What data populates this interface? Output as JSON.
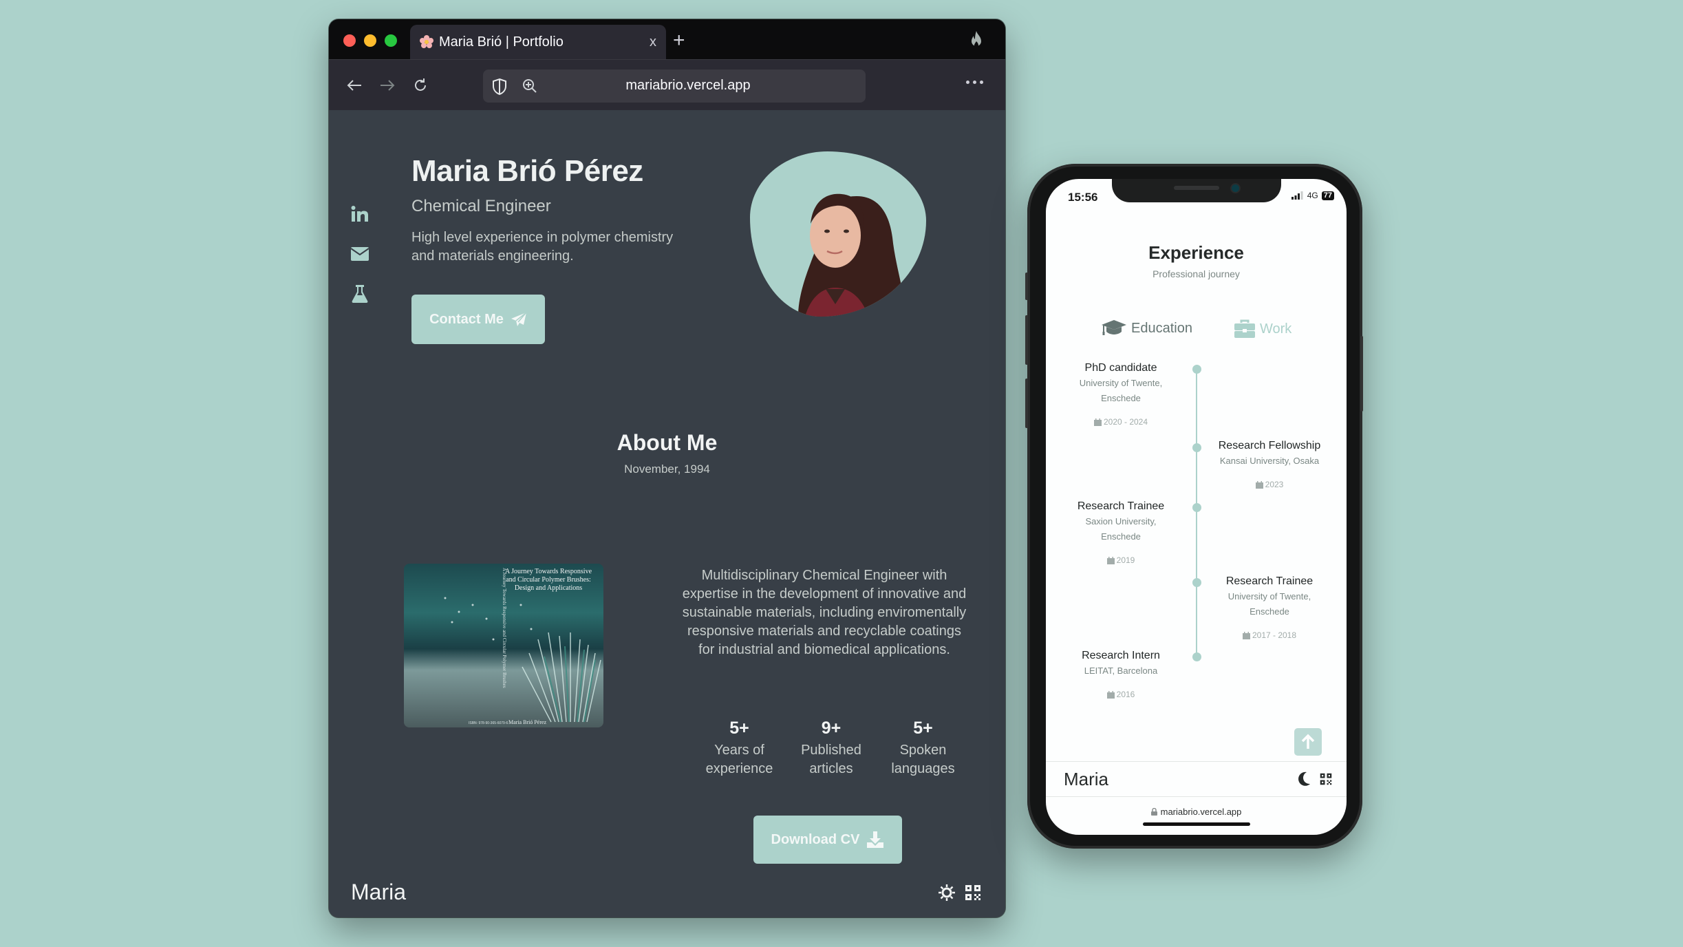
{
  "browser": {
    "tab_title": "Maria Brió | Portfolio",
    "tab_close": "x",
    "new_tab": "+",
    "url": "mariabrio.vercel.app",
    "icons": {
      "favicon": "cherry-blossom-icon",
      "private": "fire-icon",
      "back": "arrow-left-icon",
      "forward": "arrow-right-icon",
      "reload": "reload-icon",
      "shield": "shield-icon",
      "zoom": "zoom-in-icon",
      "menu": "more-horizontal-icon"
    }
  },
  "site": {
    "accent": "#acd2cb",
    "background": "#383f47",
    "social": [
      "linkedin-icon",
      "email-icon",
      "flask-icon"
    ],
    "hero": {
      "name": "Maria Brió Pérez",
      "role": "Chemical Engineer",
      "description": "High level experience in polymer chemistry and materials engineering.",
      "contact_button": "Contact Me"
    },
    "about": {
      "title": "About Me",
      "date": "November, 1994",
      "text": "Multidisciplinary Chemical Engineer with expertise in the development of innovative and sustainable materials, including enviromentally responsive materials and recyclable coatings for industrial and biomedical applications.",
      "book": {
        "title": "A Journey Towards Responsive and Circular Polymer Brushes: Design and Applications",
        "spine": "A Journey Towards Responsive and Circular Polymer Brushes",
        "author": "Maria Brió Pérez",
        "isbn": "ISBN: 978-90-365-6079-6"
      },
      "stats": [
        {
          "value": "5+",
          "label_1": "Years of",
          "label_2": "experience"
        },
        {
          "value": "9+",
          "label_1": "Published",
          "label_2": "articles"
        },
        {
          "value": "5+",
          "label_1": "Spoken",
          "label_2": "languages"
        }
      ],
      "download_button": "Download CV"
    },
    "footer": {
      "name": "Maria",
      "theme_icon": "sun-icon",
      "qr_icon": "qr-code-icon"
    }
  },
  "phone": {
    "status": {
      "time": "15:56",
      "network": "4G",
      "battery": "77"
    },
    "experience": {
      "title": "Experience",
      "subtitle": "Professional journey",
      "tabs": [
        {
          "label": "Education",
          "icon": "graduation-cap-icon",
          "active": true
        },
        {
          "label": "Work",
          "icon": "briefcase-icon",
          "active": false
        }
      ],
      "timeline": [
        {
          "title": "PhD candidate",
          "place_1": "University of Twente,",
          "place_2": "Enschede",
          "date": "2020 - 2024",
          "side": "left"
        },
        {
          "title": "Research Fellowship",
          "place_1": "Kansai University, Osaka",
          "place_2": "",
          "date": "2023",
          "side": "right"
        },
        {
          "title": "Research Trainee",
          "place_1": "Saxion University,",
          "place_2": "Enschede",
          "date": "2019",
          "side": "left"
        },
        {
          "title": "Research Trainee",
          "place_1": "University of Twente,",
          "place_2": "Enschede",
          "date": "2017 - 2018",
          "side": "right"
        },
        {
          "title": "Research Intern",
          "place_1": "LEITAT, Barcelona",
          "place_2": "",
          "date": "2016",
          "side": "left"
        }
      ]
    },
    "footer": {
      "name": "Maria",
      "theme_icon": "moon-icon",
      "qr_icon": "qr-code-icon"
    },
    "url": "mariabrio.vercel.app"
  }
}
